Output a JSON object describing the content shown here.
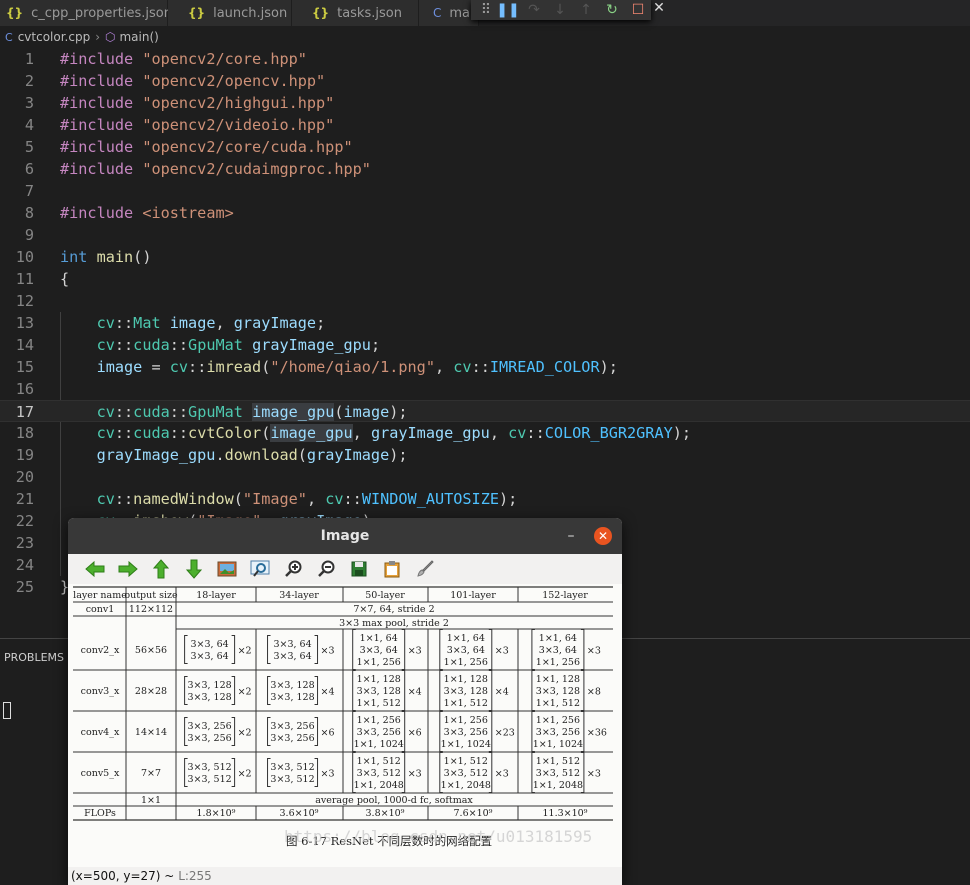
{
  "tabs": [
    {
      "label": "c_cpp_properties.json",
      "icon": "{}"
    },
    {
      "label": "launch.json",
      "icon": "{}"
    },
    {
      "label": "tasks.json",
      "icon": "{}"
    },
    {
      "label": "ma",
      "icon": "C"
    }
  ],
  "breadcrumb": {
    "file": "cvtcolor.cpp",
    "symbol": "main()"
  },
  "code_lines": [
    "1",
    "2",
    "3",
    "4",
    "5",
    "6",
    "7",
    "8",
    "9",
    "10",
    "11",
    "12",
    "13",
    "14",
    "15",
    "16",
    "17",
    "18",
    "19",
    "20",
    "21",
    "22",
    "23",
    "24",
    "25"
  ],
  "panel": {
    "title": "PROBLEMS"
  },
  "image_window": {
    "title": "Image",
    "minimize": "–",
    "close": "✕",
    "status": "(x=500, y=27) ~",
    "status_extra": "L:255"
  },
  "table": {
    "headers": [
      "layer name",
      "output size",
      "18-layer",
      "34-layer",
      "50-layer",
      "101-layer",
      "152-layer"
    ],
    "rows": [
      {
        "name": "conv1",
        "size": "112×112",
        "spec": "7×7, 64, stride 2"
      },
      {
        "name": "",
        "size": "",
        "spec": "3×3 max pool, stride 2"
      },
      {
        "name": "conv2_x",
        "size": "56×56",
        "b18": [
          "3×3, 64",
          "3×3, 64"
        ],
        "m18": "×2",
        "b34": [
          "3×3, 64",
          "3×3, 64"
        ],
        "m34": "×3",
        "b50": [
          "1×1, 64",
          "3×3, 64",
          "1×1, 256"
        ],
        "m50": "×3",
        "b101": [
          "1×1, 64",
          "3×3, 64",
          "1×1, 256"
        ],
        "m101": "×3",
        "b152": [
          "1×1, 64",
          "3×3, 64",
          "1×1, 256"
        ],
        "m152": "×3"
      },
      {
        "name": "conv3_x",
        "size": "28×28",
        "b18": [
          "3×3, 128",
          "3×3, 128"
        ],
        "m18": "×2",
        "b34": [
          "3×3, 128",
          "3×3, 128"
        ],
        "m34": "×4",
        "b50": [
          "1×1, 128",
          "3×3, 128",
          "1×1, 512"
        ],
        "m50": "×4",
        "b101": [
          "1×1, 128",
          "3×3, 128",
          "1×1, 512"
        ],
        "m101": "×4",
        "b152": [
          "1×1, 128",
          "3×3, 128",
          "1×1, 512"
        ],
        "m152": "×8"
      },
      {
        "name": "conv4_x",
        "size": "14×14",
        "b18": [
          "3×3, 256",
          "3×3, 256"
        ],
        "m18": "×2",
        "b34": [
          "3×3, 256",
          "3×3, 256"
        ],
        "m34": "×6",
        "b50": [
          "1×1, 256",
          "3×3, 256",
          "1×1, 1024"
        ],
        "m50": "×6",
        "b101": [
          "1×1, 256",
          "3×3, 256",
          "1×1, 1024"
        ],
        "m101": "×23",
        "b152": [
          "1×1, 256",
          "3×3, 256",
          "1×1, 1024"
        ],
        "m152": "×36"
      },
      {
        "name": "conv5_x",
        "size": "7×7",
        "b18": [
          "3×3, 512",
          "3×3, 512"
        ],
        "m18": "×2",
        "b34": [
          "3×3, 512",
          "3×3, 512"
        ],
        "m34": "×3",
        "b50": [
          "1×1, 512",
          "3×3, 512",
          "1×1, 2048"
        ],
        "m50": "×3",
        "b101": [
          "1×1, 512",
          "3×3, 512",
          "1×1, 2048"
        ],
        "m101": "×3",
        "b152": [
          "1×1, 512",
          "3×3, 512",
          "1×1, 2048"
        ],
        "m152": "×3"
      },
      {
        "name": "",
        "size": "1×1",
        "spec": "average pool, 1000-d fc, softmax"
      },
      {
        "name": "FLOPs",
        "size": "",
        "flops": [
          "1.8×10⁹",
          "3.6×10⁹",
          "3.8×10⁹",
          "7.6×10⁹",
          "11.3×10⁹"
        ]
      }
    ],
    "caption": "图 6-17   ResNet 不同层数时的网络配置",
    "watermark": "https://blog.csdn.net/u013181595"
  }
}
